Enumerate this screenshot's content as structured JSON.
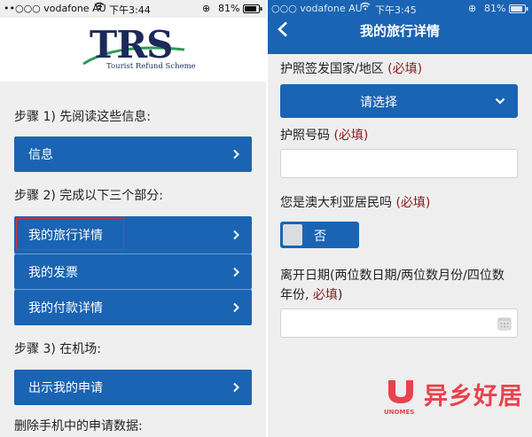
{
  "left": {
    "status": {
      "carrier": "••○○○ vodafone AU",
      "time": "下午3:44",
      "battery": "81%"
    },
    "logo": {
      "text": "TRS",
      "subtitle": "Tourist Refund Scheme"
    },
    "step1": {
      "label": "步骤 1) 先阅读这些信息:",
      "buttons": [
        "信息"
      ]
    },
    "step2": {
      "label": "步骤 2) 完成以下三个部分:",
      "buttons": [
        "我的旅行详情",
        "我的发票",
        "我的付款详情"
      ]
    },
    "step3": {
      "label": "步骤 3) 在机场:",
      "buttons": [
        "出示我的申请"
      ]
    },
    "footer": "删除手机中的申请数据:",
    "accent": "#1a64b3",
    "highlight_color": "#d62f3a"
  },
  "right": {
    "status": {
      "carrier": "○○○ vodafone AU",
      "time": "下午3:45",
      "battery": "81%"
    },
    "nav": {
      "title": "我的旅行详情",
      "back_icon": "chevron-left-icon"
    },
    "passport_country": {
      "label": "护照签发国家/地区",
      "required": "(必填)",
      "select_label": "请选择"
    },
    "passport_number": {
      "label": "护照号码",
      "required": "(必填)",
      "value": ""
    },
    "resident": {
      "label": "您是澳大利亚居民吗",
      "required": "(必填)",
      "toggle_label": "否"
    },
    "departure": {
      "label_line1": "离开日期(两位数日期/两位数月份/四位数",
      "label_line2": "年份,",
      "required": "必填",
      "label_end": ")",
      "value": ""
    }
  },
  "watermark": {
    "text": "异乡好居",
    "small": "UNOMES"
  }
}
